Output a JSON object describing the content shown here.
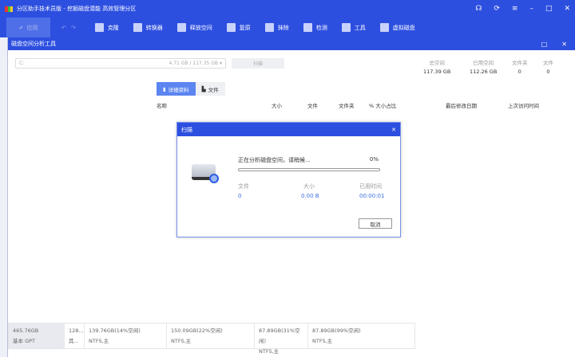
{
  "window": {
    "title": "分区助手技术员版 - 挖掘磁盘潜能 高效管理分区",
    "controls": [
      "headset",
      "refresh",
      "menu",
      "minimize",
      "maximize",
      "close"
    ]
  },
  "toolbar": {
    "apply": "应用",
    "items": [
      "克隆",
      "转换器",
      "释放空间",
      "复原",
      "抹除",
      "检测",
      "工具",
      "虚拟磁盘"
    ]
  },
  "subwindow": {
    "title": "磁盘空间分析工具"
  },
  "drive": {
    "letter": "C:",
    "usage": "4.71 GB / 117.35 GB",
    "scan": "扫描"
  },
  "stats": [
    {
      "label": "总空间",
      "value": "117.39 GB"
    },
    {
      "label": "已用空间",
      "value": "112.26 GB"
    },
    {
      "label": "文件夹",
      "value": "0"
    },
    {
      "label": "文件",
      "value": "0"
    }
  ],
  "tabs": [
    "详细资料",
    "文件"
  ],
  "columns": [
    "名称",
    "大小",
    "文件",
    "文件夹",
    "% 大小占比",
    "最后修改日期",
    "上次访问时间"
  ],
  "dialog": {
    "title": "扫描",
    "message": "正在分析磁盘空间，请稍候...",
    "percent": "0%",
    "progress": 0,
    "files_label": "文件",
    "files": "0",
    "size_label": "大小",
    "size": "0.00 B",
    "time_label": "已用时间",
    "time": "00:00:01",
    "cancel": "取消"
  },
  "disk": {
    "size": "465.76GB",
    "type": "基本 GPT",
    "parts": [
      {
        "a": "128...",
        "b": "其..."
      },
      {
        "a": "139.76GB(14%空闲)",
        "b": "NTFS,主"
      },
      {
        "a": "150.09GB(22%空闲)",
        "b": "NTFS,主"
      },
      {
        "a": "87.89GB(31%空闲)",
        "b": "NTFS,主"
      },
      {
        "a": "87.89GB(99%空闲)",
        "b": "NTFS,主"
      }
    ]
  }
}
